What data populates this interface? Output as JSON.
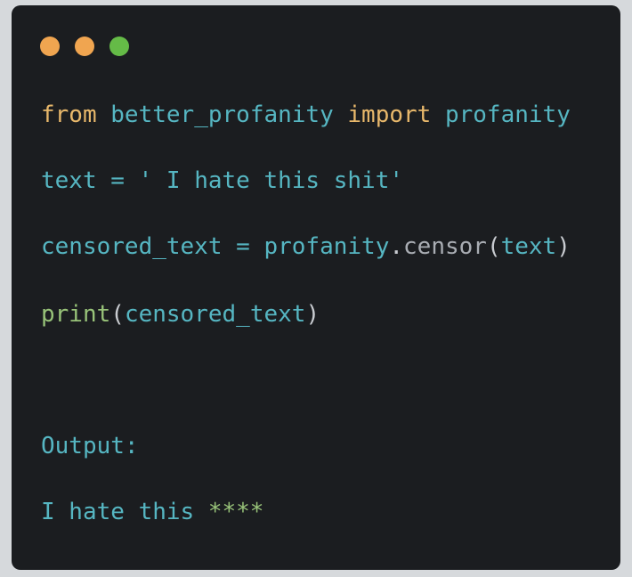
{
  "window_controls": [
    {
      "name": "close",
      "color": "#f0a550"
    },
    {
      "name": "minimize",
      "color": "#f0a550"
    },
    {
      "name": "maximize",
      "color": "#65bb47"
    }
  ],
  "colors": {
    "background": "#1b1d20",
    "keyword": "#e8b86b",
    "identifier": "#56b6c2",
    "function": "#98c379",
    "string": "#98c379",
    "punctuation": "#c9ccd1",
    "method": "#a9adb3"
  },
  "code": {
    "line1": {
      "kw_from": "from",
      "module": "better_profanity",
      "kw_import": "import",
      "name": "profanity"
    },
    "line2": {
      "var": "text",
      "op": "=",
      "string": "' I hate this shit'"
    },
    "line3": {
      "var": "censored_text",
      "op": "=",
      "obj": "profanity",
      "dot": ".",
      "method": "censor",
      "lparen": "(",
      "arg": "text",
      "rparen": ")"
    },
    "line4": {
      "func": "print",
      "lparen": "(",
      "arg": "censored_text",
      "rparen": ")"
    }
  },
  "output": {
    "label": "Output:",
    "text": "I hate this",
    "masked": "****"
  }
}
